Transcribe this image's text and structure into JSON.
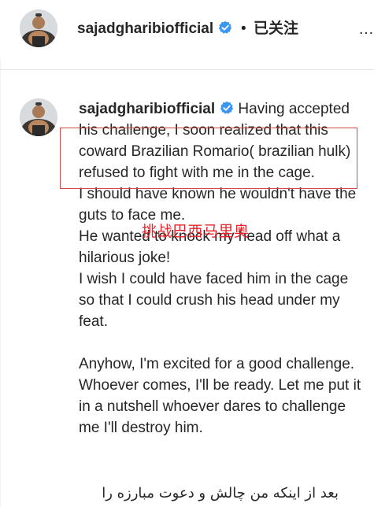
{
  "header": {
    "username": "sajadgharibiofficial",
    "dot": "•",
    "follow_status": "已关注",
    "more_icon": "ellipsis-icon"
  },
  "post": {
    "username": "sajadgharibiofficial",
    "caption": " Having accepted his challenge, I soon realized that this coward Brazilian Romario( brazilian hulk) refused to fight with me in the cage.\nI should have known he wouldn't have the guts to face me.\nHe wanted to knock my head off what a hilarious joke!\nI wish I could have faced him in the cage so that I could crush his head under my feat.\n\nAnyhow, I'm excited for a good challenge. Whoever comes, I'll be ready. Let me put it in a nutshell whoever dares to challenge me I'll destroy him.",
    "persian_line": "بعد از اینکه من چالش و دعوت مبارزه را"
  },
  "annotation": {
    "text": "挑战巴西马里奥",
    "color": "#e8242a",
    "box_color": "#d9464a"
  },
  "colors": {
    "verified_badge": "#3897f0",
    "text": "#262626"
  }
}
